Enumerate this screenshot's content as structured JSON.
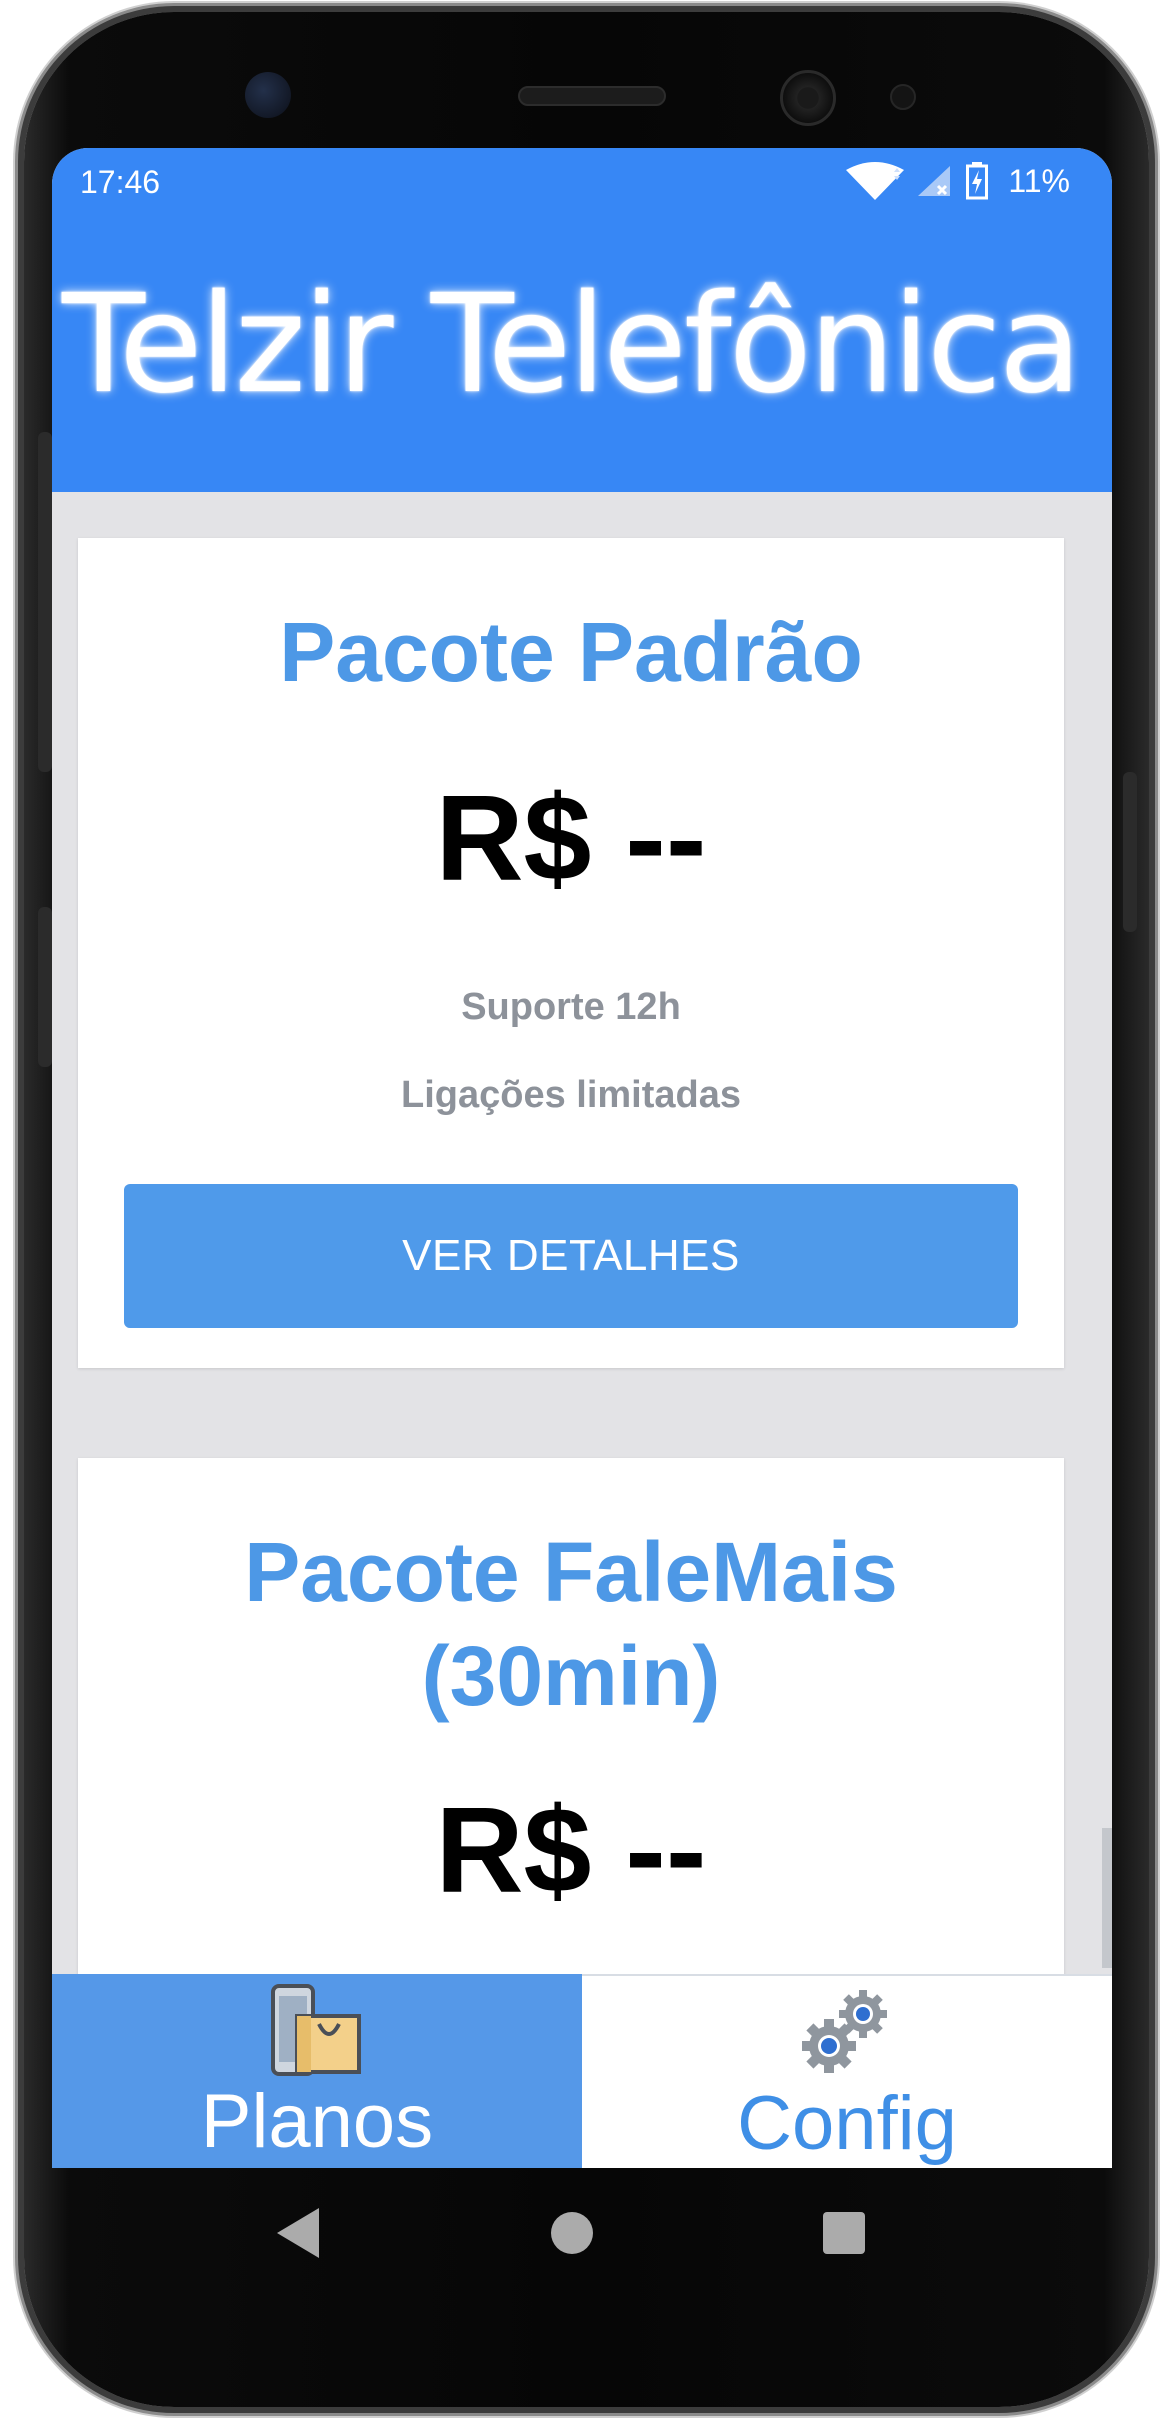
{
  "status_bar": {
    "time": "17:46",
    "battery": "11%"
  },
  "header": {
    "title": "Telzir Telefônica"
  },
  "plans": [
    {
      "title": "Pacote Padrão",
      "price": "R$ --",
      "features": [
        "Suporte 12h",
        "Ligações limitadas"
      ],
      "button_label": "VER DETALHES"
    },
    {
      "title_line1": "Pacote FaleMais",
      "title_line2": "(30min)",
      "price": "R$ --"
    }
  ],
  "bottom_nav": {
    "planos": {
      "label": "Planos",
      "icon": "shopping-bag-phone-icon",
      "active": true
    },
    "config": {
      "label": "Config",
      "icon": "gears-icon",
      "active": false
    }
  },
  "system_nav": {
    "back_icon": "back-triangle-icon",
    "home_icon": "home-circle-icon",
    "recents_icon": "recents-square-icon"
  },
  "colors": {
    "header_blue": "#3787f5",
    "title_blue": "#4d98e6",
    "button_blue": "#4f9aea",
    "active_tab": "#5598e8",
    "feature_gray": "#8d929a"
  }
}
